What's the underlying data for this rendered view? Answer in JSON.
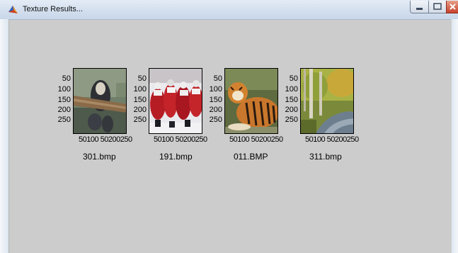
{
  "window": {
    "title": "Texture Results...",
    "icon": "matlab-icon",
    "controls": [
      "minimize-icon",
      "maximize-icon",
      "close-icon"
    ]
  },
  "images": [
    {
      "filename": "301.bmp",
      "subject": "monkey on branch",
      "y_ticks": [
        "50",
        "100",
        "150",
        "200",
        "250"
      ],
      "x_ticks": "50100 50200250"
    },
    {
      "filename": "191.bmp",
      "subject": "hockey team in red",
      "y_ticks": [
        "50",
        "100",
        "150",
        "200",
        "250"
      ],
      "x_ticks": "50100 50200250"
    },
    {
      "filename": "011.BMP",
      "subject": "tiger lying",
      "y_ticks": [
        "50",
        "100",
        "150",
        "200",
        "250"
      ],
      "x_ticks": "50100 50200250"
    },
    {
      "filename": "311.bmp",
      "subject": "forest stream",
      "y_ticks": [
        "50",
        "100",
        "150",
        "200",
        "250"
      ],
      "x_ticks": "50100 50200250"
    }
  ],
  "colors": {
    "figure_bg": "#cccccc",
    "titlebar": "#d3dfee",
    "close": "#c7412a"
  }
}
